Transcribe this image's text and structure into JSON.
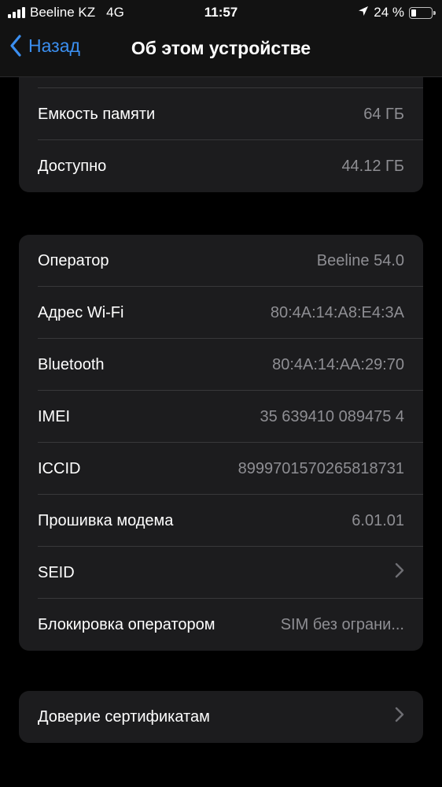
{
  "status_bar": {
    "carrier": "Beeline KZ",
    "network": "4G",
    "time": "11:57",
    "battery": "24 %",
    "battery_level": 0.24
  },
  "nav": {
    "back_label": "Назад",
    "title": "Об этом устройстве"
  },
  "storage": [
    {
      "label": "Емкость памяти",
      "value": "64 ГБ"
    },
    {
      "label": "Доступно",
      "value": "44.12 ГБ"
    }
  ],
  "network_info": [
    {
      "label": "Оператор",
      "value": "Beeline 54.0"
    },
    {
      "label": "Адрес Wi-Fi",
      "value": "80:4A:14:A8:E4:3A"
    },
    {
      "label": "Bluetooth",
      "value": "80:4A:14:AA:29:70"
    },
    {
      "label": "IMEI",
      "value": "35 639410 089475 4"
    },
    {
      "label": "ICCID",
      "value": "8999701570265818731"
    },
    {
      "label": "Прошивка модема",
      "value": "6.01.01"
    },
    {
      "label": "SEID",
      "value": ""
    },
    {
      "label": "Блокировка оператором",
      "value": "SIM без ограни..."
    }
  ],
  "certificates": {
    "label": "Доверие сертификатам"
  },
  "colors": {
    "background": "#000000",
    "card": "#1c1c1e",
    "accent": "#3b8ff0",
    "secondary_text": "#8e8e93"
  }
}
